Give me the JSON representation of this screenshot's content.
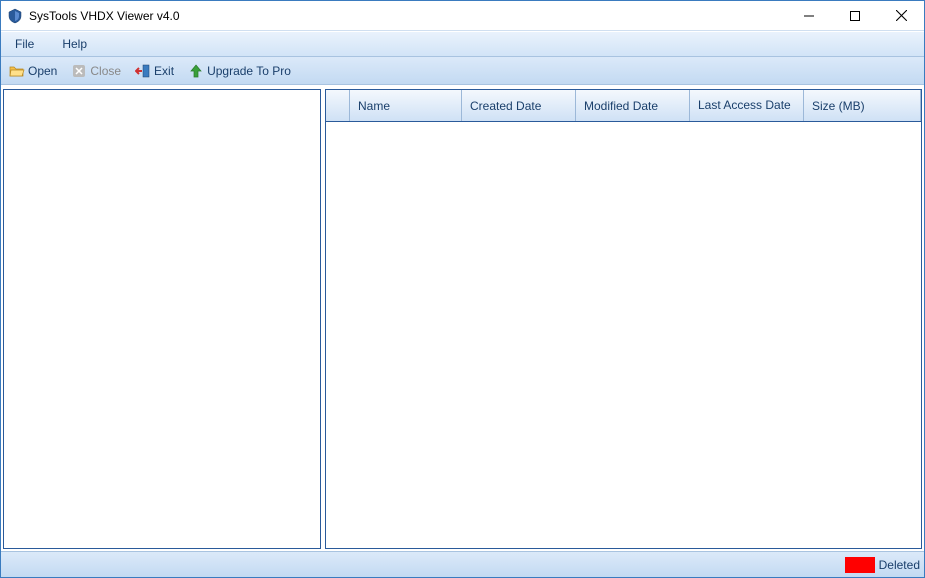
{
  "window": {
    "title": "SysTools VHDX Viewer v4.0"
  },
  "menu": {
    "file": "File",
    "help": "Help"
  },
  "toolbar": {
    "open": "Open",
    "close": "Close",
    "exit": "Exit",
    "upgrade": "Upgrade To Pro"
  },
  "columns": {
    "name": "Name",
    "created": "Created Date",
    "modified": "Modified Date",
    "access": "Last Access Date",
    "size": "Size (MB)"
  },
  "status": {
    "deleted_label": "Deleted",
    "deleted_color": "#ff0000"
  }
}
